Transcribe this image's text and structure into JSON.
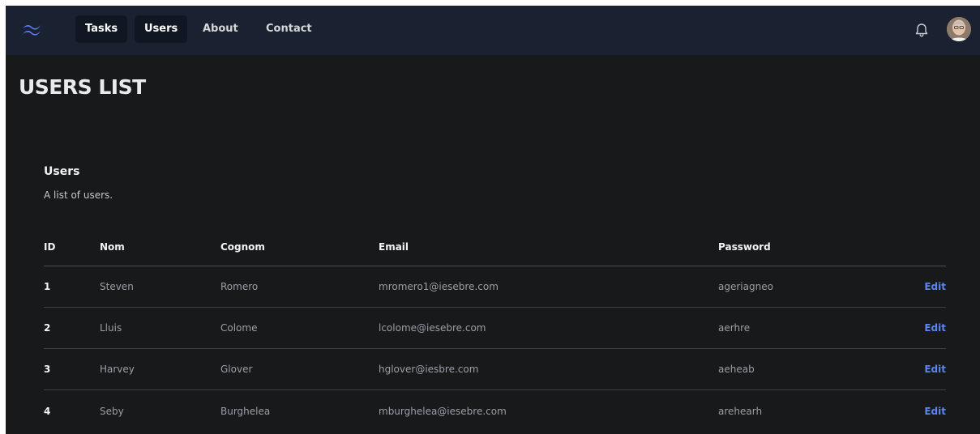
{
  "nav": {
    "links": [
      {
        "label": "Tasks",
        "active": true
      },
      {
        "label": "Users",
        "active": true
      },
      {
        "label": "About",
        "active": false
      },
      {
        "label": "Contact",
        "active": false
      }
    ],
    "icons": [
      "logo-icon",
      "bell-icon",
      "avatar"
    ]
  },
  "page": {
    "title": "USERS LIST"
  },
  "section": {
    "title": "Users",
    "subtitle": "A list of users."
  },
  "table": {
    "headers": [
      "ID",
      "Nom",
      "Cognom",
      "Email",
      "Password"
    ],
    "rows": [
      {
        "id": "1",
        "nom": "Steven",
        "cognom": "Romero",
        "email": "mromero1@iesebre.com",
        "password": "ageriagneo",
        "action": "Edit"
      },
      {
        "id": "2",
        "nom": "Lluis",
        "cognom": "Colome",
        "email": "lcolome@iesebre.com",
        "password": "aerhre",
        "action": "Edit"
      },
      {
        "id": "3",
        "nom": "Harvey",
        "cognom": "Glover",
        "email": "hglover@iesbre.com",
        "password": "aeheab",
        "action": "Edit"
      },
      {
        "id": "4",
        "nom": "Seby",
        "cognom": "Burghelea",
        "email": "mburghelea@iesebre.com",
        "password": "arehearh",
        "action": "Edit"
      }
    ]
  },
  "colors": {
    "navbar": "#1a2130",
    "background": "#18191b",
    "link_accent": "#5b84f6"
  }
}
